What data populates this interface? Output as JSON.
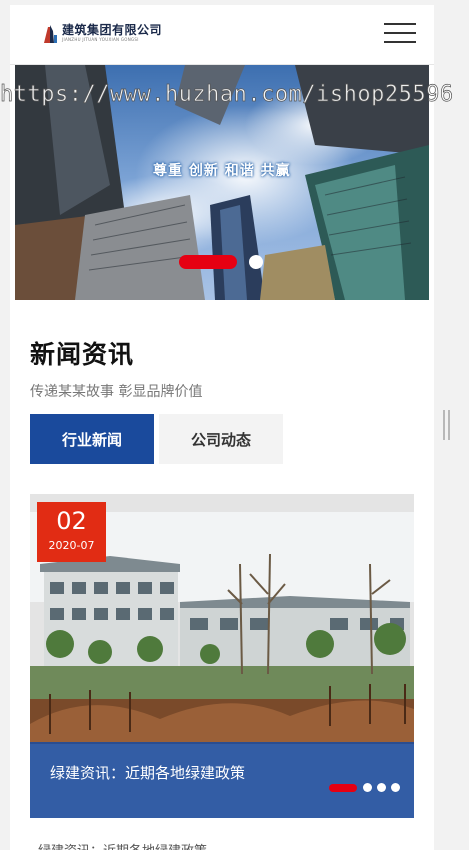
{
  "header": {
    "logo_cn": "建筑集团有限公司",
    "logo_en": "JIANZHU JITUAN YOUXIAN GONGSI",
    "menu_icon": "hamburger-menu-icon"
  },
  "watermark": "https://www.huzhan.com/ishop25596",
  "banner": {
    "slogan": "尊重 创新 和谐 共赢",
    "slide_count": 2,
    "active_slide": 1
  },
  "news": {
    "title": "新闻资讯",
    "subtitle": "传递某某故事 彰显品牌价值",
    "tabs": [
      {
        "label": "行业新闻",
        "active": true
      },
      {
        "label": "公司动态",
        "active": false
      }
    ],
    "featured": {
      "day": "02",
      "year_month": "2020-07",
      "caption": "绿建资讯：近期各地绿建政策",
      "slide_count": 4,
      "active_slide": 1
    },
    "next_item_text": "绿建资讯：近期各地绿建政策"
  },
  "colors": {
    "primary": "#1a4a9c",
    "accent": "#e60012",
    "date_badge": "#e12c14"
  }
}
